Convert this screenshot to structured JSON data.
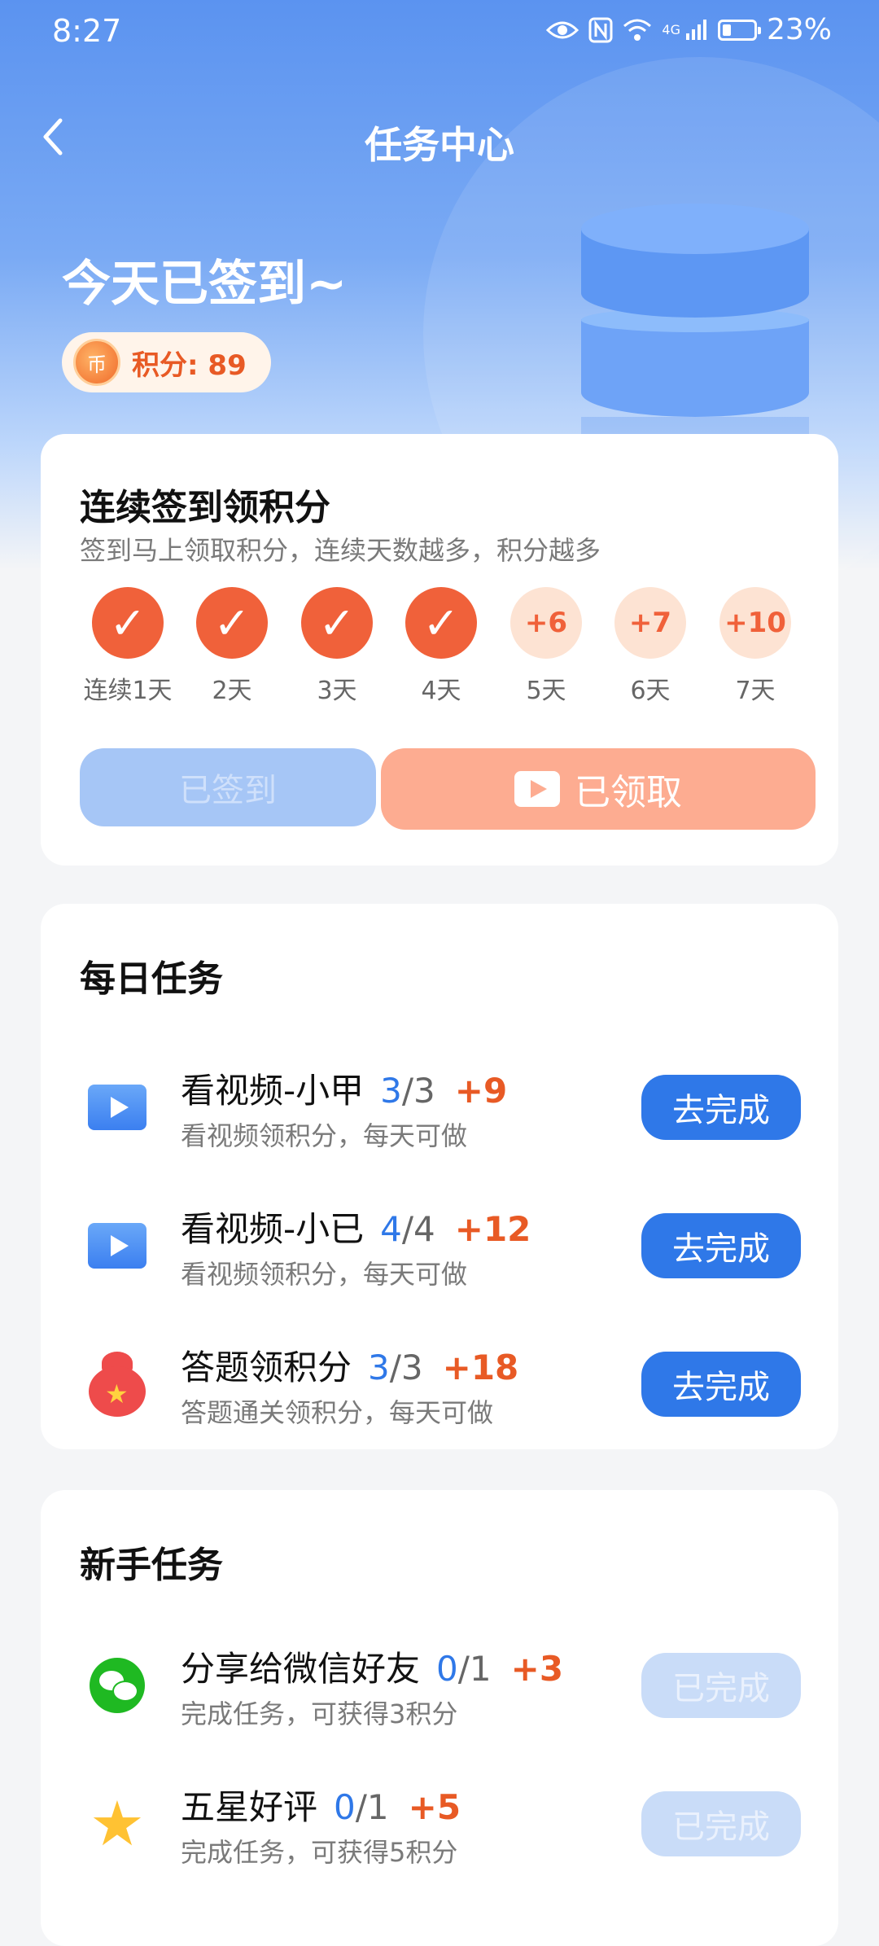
{
  "status_bar": {
    "time": "8:27",
    "network": "4G",
    "battery": "23%"
  },
  "nav": {
    "back": "‹",
    "title": "任务中心"
  },
  "header": {
    "signed_text": "今天已签到~",
    "points_label": "积分: 89",
    "coin_glyph": "币"
  },
  "checkin": {
    "title": "连续签到领积分",
    "subtitle": "签到马上领取积分，连续天数越多，积分越多",
    "days": [
      {
        "label": "连续1天",
        "state": "done",
        "mark": "✓"
      },
      {
        "label": "2天",
        "state": "done",
        "mark": "✓"
      },
      {
        "label": "3天",
        "state": "done",
        "mark": "✓"
      },
      {
        "label": "4天",
        "state": "done",
        "mark": "✓"
      },
      {
        "label": "5天",
        "state": "todo",
        "mark": "+6"
      },
      {
        "label": "6天",
        "state": "todo",
        "mark": "+7"
      },
      {
        "label": "7天",
        "state": "todo",
        "mark": "+10"
      }
    ],
    "signed_button": "已签到",
    "claimed_button": "已领取"
  },
  "daily": {
    "title": "每日任务",
    "tasks": [
      {
        "name": "看视频-小甲",
        "done": "3",
        "total": "/3",
        "bonus": "+9",
        "desc": "看视频领积分，每天可做",
        "button": "去完成"
      },
      {
        "name": "看视频-小已",
        "done": "4",
        "total": "/4",
        "bonus": "+12",
        "desc": "看视频领积分，每天可做",
        "button": "去完成"
      },
      {
        "name": "答题领积分",
        "done": "3",
        "total": "/3",
        "bonus": "+18",
        "desc": "答题通关领积分，每天可做",
        "button": "去完成"
      }
    ]
  },
  "newbie": {
    "title": "新手任务",
    "tasks": [
      {
        "name": "分享给微信好友",
        "done": "0",
        "total": "/1",
        "bonus": "+3",
        "desc": "完成任务，可获得3积分",
        "button": "已完成"
      },
      {
        "name": "五星好评",
        "done": "0",
        "total": "/1",
        "bonus": "+5",
        "desc": "完成任务，可获得5积分",
        "button": "已完成"
      }
    ]
  },
  "icons": {
    "eye": "eye-icon",
    "nfc": "nfc-icon",
    "wifi": "wifi-icon",
    "signal": "signal-icon",
    "battery": "battery-icon",
    "video": "video-icon",
    "quiz": "red-bag-icon",
    "wechat": "wechat-icon",
    "star": "star-icon"
  }
}
